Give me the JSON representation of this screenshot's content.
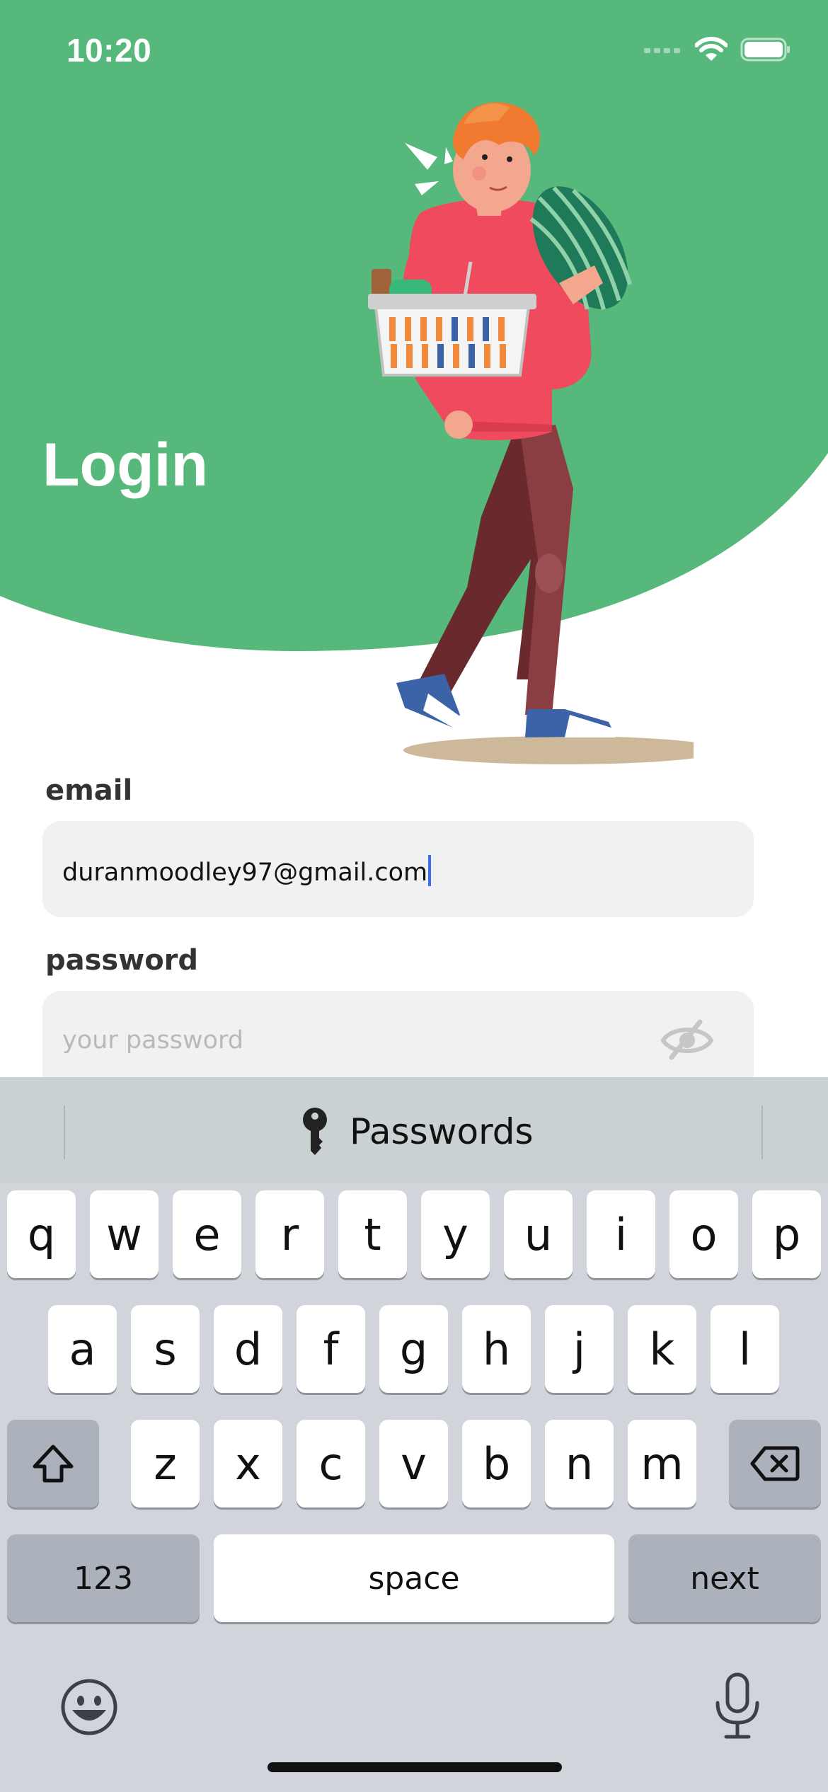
{
  "status_bar": {
    "time": "10:20"
  },
  "page": {
    "title": "Login"
  },
  "form": {
    "email_label": "email",
    "email_value": "duranmoodley97@gmail.com",
    "password_label": "password",
    "password_placeholder": "your password"
  },
  "keyboard": {
    "suggestion": "Passwords",
    "row1": [
      "q",
      "w",
      "e",
      "r",
      "t",
      "y",
      "u",
      "i",
      "o",
      "p"
    ],
    "row2": [
      "a",
      "s",
      "d",
      "f",
      "g",
      "h",
      "j",
      "k",
      "l"
    ],
    "row3": [
      "z",
      "x",
      "c",
      "v",
      "b",
      "n",
      "m"
    ],
    "numbers_key": "123",
    "space_key": "space",
    "next_key": "next"
  },
  "colors": {
    "brand_green": "#56b87b",
    "caret_blue": "#3b6cf6",
    "keyboard_bg": "#d1d5db"
  },
  "icons": [
    "wifi-icon",
    "battery-icon",
    "cellular-signal-icon",
    "eye-slash-icon",
    "key-icon",
    "shift-icon",
    "backspace-icon",
    "emoji-icon",
    "microphone-icon"
  ]
}
